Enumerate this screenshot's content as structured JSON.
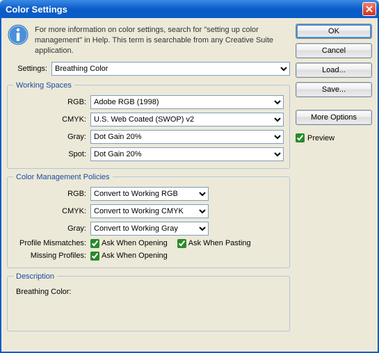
{
  "title": "Color Settings",
  "info": "For more information on color settings, search for \"setting up color management\" in Help. This term is searchable from any Creative Suite application.",
  "settings_label": "Settings:",
  "settings_value": "Breathing Color",
  "working_spaces": {
    "legend": "Working Spaces",
    "rgb_label": "RGB:",
    "rgb_value": "Adobe RGB (1998)",
    "cmyk_label": "CMYK:",
    "cmyk_value": "U.S. Web Coated (SWOP) v2",
    "gray_label": "Gray:",
    "gray_value": "Dot Gain 20%",
    "spot_label": "Spot:",
    "spot_value": "Dot Gain 20%"
  },
  "policies": {
    "legend": "Color Management Policies",
    "rgb_label": "RGB:",
    "rgb_value": "Convert to Working RGB",
    "cmyk_label": "CMYK:",
    "cmyk_value": "Convert to Working CMYK",
    "gray_label": "Gray:",
    "gray_value": "Convert to Working Gray",
    "mismatch_label": "Profile Mismatches:",
    "ask_opening": "Ask When Opening",
    "ask_pasting": "Ask When Pasting",
    "missing_label": "Missing Profiles:",
    "ask_opening2": "Ask When Opening"
  },
  "description": {
    "legend": "Description",
    "text": "Breathing Color:"
  },
  "buttons": {
    "ok": "OK",
    "cancel": "Cancel",
    "load": "Load...",
    "save": "Save...",
    "more": "More Options"
  },
  "preview_label": "Preview"
}
